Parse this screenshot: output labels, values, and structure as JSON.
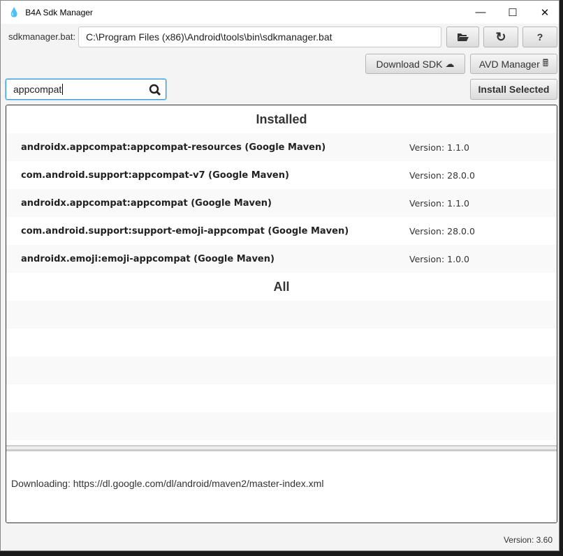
{
  "window": {
    "title": "B4A Sdk Manager",
    "minimize": "—",
    "maximize": "☐",
    "close": "✕",
    "icon": "b4a-flame-icon"
  },
  "toolbar": {
    "sdk_label": "sdkmanager.bat:",
    "sdk_path": "C:\\Program Files (x86)\\Android\\tools\\bin\\sdkmanager.bat",
    "browse_icon": "folder-open-icon",
    "refresh_icon": "refresh-icon",
    "help_label": "?",
    "download_sdk": "Download SDK",
    "avd_manager": "AVD Manager",
    "install_selected": "Install Selected"
  },
  "search": {
    "value": "appcompat",
    "icon": "search-icon"
  },
  "list": {
    "installed_header": "Installed",
    "installed": [
      {
        "name": "androidx.appcompat:appcompat-resources (Google Maven)",
        "version": "Version: 1.1.0"
      },
      {
        "name": "com.android.support:appcompat-v7 (Google Maven)",
        "version": "Version: 28.0.0"
      },
      {
        "name": "androidx.appcompat:appcompat (Google Maven)",
        "version": "Version: 1.1.0"
      },
      {
        "name": "com.android.support:support-emoji-appcompat (Google Maven)",
        "version": "Version: 28.0.0"
      },
      {
        "name": "androidx.emoji:emoji-appcompat (Google Maven)",
        "version": "Version: 1.0.0"
      }
    ],
    "all_header": "All"
  },
  "log": {
    "text": "Downloading: https://dl.google.com/dl/android/maven2/master-index.xml"
  },
  "footer": {
    "version": "Version: 3.60"
  }
}
